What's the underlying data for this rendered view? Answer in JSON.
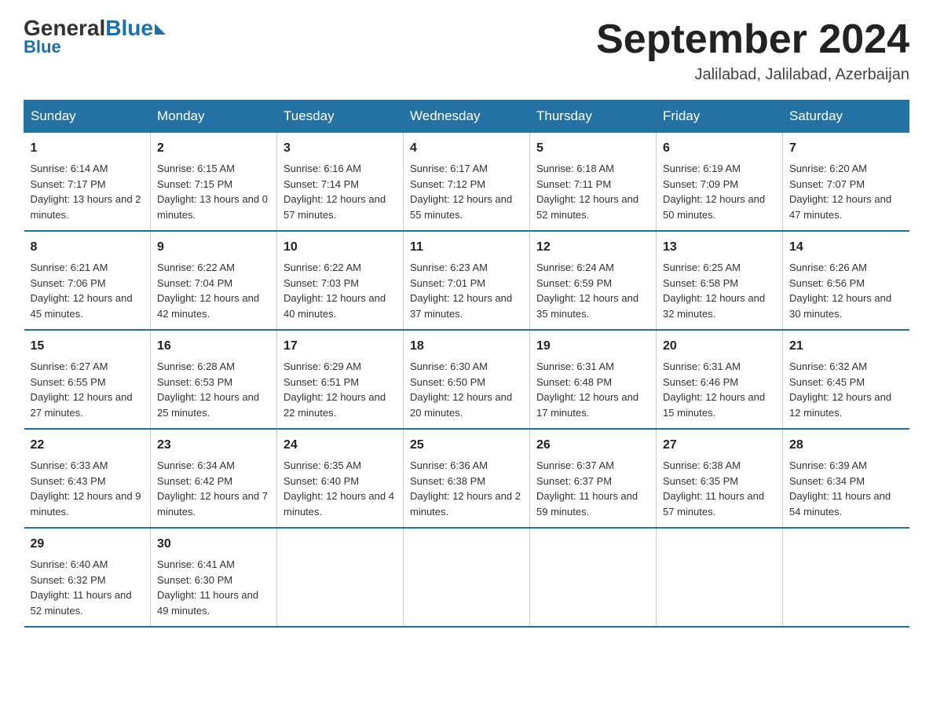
{
  "header": {
    "logo_general": "General",
    "logo_blue": "Blue",
    "month_title": "September 2024",
    "location": "Jalilabad, Jalilabad, Azerbaijan"
  },
  "weekdays": [
    "Sunday",
    "Monday",
    "Tuesday",
    "Wednesday",
    "Thursday",
    "Friday",
    "Saturday"
  ],
  "weeks": [
    [
      {
        "day": "1",
        "sunrise": "6:14 AM",
        "sunset": "7:17 PM",
        "daylight": "13 hours and 2 minutes."
      },
      {
        "day": "2",
        "sunrise": "6:15 AM",
        "sunset": "7:15 PM",
        "daylight": "13 hours and 0 minutes."
      },
      {
        "day": "3",
        "sunrise": "6:16 AM",
        "sunset": "7:14 PM",
        "daylight": "12 hours and 57 minutes."
      },
      {
        "day": "4",
        "sunrise": "6:17 AM",
        "sunset": "7:12 PM",
        "daylight": "12 hours and 55 minutes."
      },
      {
        "day": "5",
        "sunrise": "6:18 AM",
        "sunset": "7:11 PM",
        "daylight": "12 hours and 52 minutes."
      },
      {
        "day": "6",
        "sunrise": "6:19 AM",
        "sunset": "7:09 PM",
        "daylight": "12 hours and 50 minutes."
      },
      {
        "day": "7",
        "sunrise": "6:20 AM",
        "sunset": "7:07 PM",
        "daylight": "12 hours and 47 minutes."
      }
    ],
    [
      {
        "day": "8",
        "sunrise": "6:21 AM",
        "sunset": "7:06 PM",
        "daylight": "12 hours and 45 minutes."
      },
      {
        "day": "9",
        "sunrise": "6:22 AM",
        "sunset": "7:04 PM",
        "daylight": "12 hours and 42 minutes."
      },
      {
        "day": "10",
        "sunrise": "6:22 AM",
        "sunset": "7:03 PM",
        "daylight": "12 hours and 40 minutes."
      },
      {
        "day": "11",
        "sunrise": "6:23 AM",
        "sunset": "7:01 PM",
        "daylight": "12 hours and 37 minutes."
      },
      {
        "day": "12",
        "sunrise": "6:24 AM",
        "sunset": "6:59 PM",
        "daylight": "12 hours and 35 minutes."
      },
      {
        "day": "13",
        "sunrise": "6:25 AM",
        "sunset": "6:58 PM",
        "daylight": "12 hours and 32 minutes."
      },
      {
        "day": "14",
        "sunrise": "6:26 AM",
        "sunset": "6:56 PM",
        "daylight": "12 hours and 30 minutes."
      }
    ],
    [
      {
        "day": "15",
        "sunrise": "6:27 AM",
        "sunset": "6:55 PM",
        "daylight": "12 hours and 27 minutes."
      },
      {
        "day": "16",
        "sunrise": "6:28 AM",
        "sunset": "6:53 PM",
        "daylight": "12 hours and 25 minutes."
      },
      {
        "day": "17",
        "sunrise": "6:29 AM",
        "sunset": "6:51 PM",
        "daylight": "12 hours and 22 minutes."
      },
      {
        "day": "18",
        "sunrise": "6:30 AM",
        "sunset": "6:50 PM",
        "daylight": "12 hours and 20 minutes."
      },
      {
        "day": "19",
        "sunrise": "6:31 AM",
        "sunset": "6:48 PM",
        "daylight": "12 hours and 17 minutes."
      },
      {
        "day": "20",
        "sunrise": "6:31 AM",
        "sunset": "6:46 PM",
        "daylight": "12 hours and 15 minutes."
      },
      {
        "day": "21",
        "sunrise": "6:32 AM",
        "sunset": "6:45 PM",
        "daylight": "12 hours and 12 minutes."
      }
    ],
    [
      {
        "day": "22",
        "sunrise": "6:33 AM",
        "sunset": "6:43 PM",
        "daylight": "12 hours and 9 minutes."
      },
      {
        "day": "23",
        "sunrise": "6:34 AM",
        "sunset": "6:42 PM",
        "daylight": "12 hours and 7 minutes."
      },
      {
        "day": "24",
        "sunrise": "6:35 AM",
        "sunset": "6:40 PM",
        "daylight": "12 hours and 4 minutes."
      },
      {
        "day": "25",
        "sunrise": "6:36 AM",
        "sunset": "6:38 PM",
        "daylight": "12 hours and 2 minutes."
      },
      {
        "day": "26",
        "sunrise": "6:37 AM",
        "sunset": "6:37 PM",
        "daylight": "11 hours and 59 minutes."
      },
      {
        "day": "27",
        "sunrise": "6:38 AM",
        "sunset": "6:35 PM",
        "daylight": "11 hours and 57 minutes."
      },
      {
        "day": "28",
        "sunrise": "6:39 AM",
        "sunset": "6:34 PM",
        "daylight": "11 hours and 54 minutes."
      }
    ],
    [
      {
        "day": "29",
        "sunrise": "6:40 AM",
        "sunset": "6:32 PM",
        "daylight": "11 hours and 52 minutes."
      },
      {
        "day": "30",
        "sunrise": "6:41 AM",
        "sunset": "6:30 PM",
        "daylight": "11 hours and 49 minutes."
      },
      null,
      null,
      null,
      null,
      null
    ]
  ]
}
